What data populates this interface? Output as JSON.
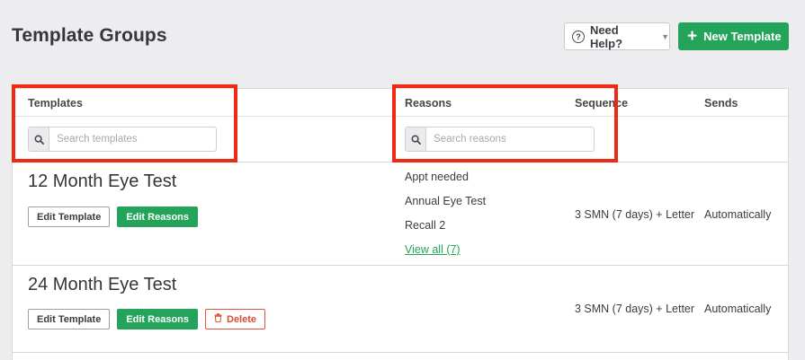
{
  "header": {
    "title": "Template Groups",
    "help_label": "Need Help?",
    "new_template_label": "New Template"
  },
  "table": {
    "columns": {
      "templates": "Templates",
      "reasons": "Reasons",
      "sequence": "Sequence",
      "sends": "Sends"
    },
    "search_templates_placeholder": "Search templates",
    "search_reasons_placeholder": "Search reasons",
    "rows": [
      {
        "name": "12 Month Eye Test",
        "edit_template_label": "Edit Template",
        "edit_reasons_label": "Edit Reasons",
        "reasons": [
          "Appt needed",
          "Annual Eye Test",
          "Recall 2"
        ],
        "view_all_label": "View all (7)",
        "sequence": "3 SMN (7 days) + Letter",
        "sends": "Automatically"
      },
      {
        "name": "24 Month Eye Test",
        "edit_template_label": "Edit Template",
        "edit_reasons_label": "Edit Reasons",
        "delete_label": "Delete",
        "sequence": "3 SMN (7 days) + Letter",
        "sends": "Automatically"
      }
    ]
  },
  "colors": {
    "accent": "#24a35a",
    "danger": "#d94a31",
    "highlight": "#ee2a12",
    "background": "#ededef"
  }
}
